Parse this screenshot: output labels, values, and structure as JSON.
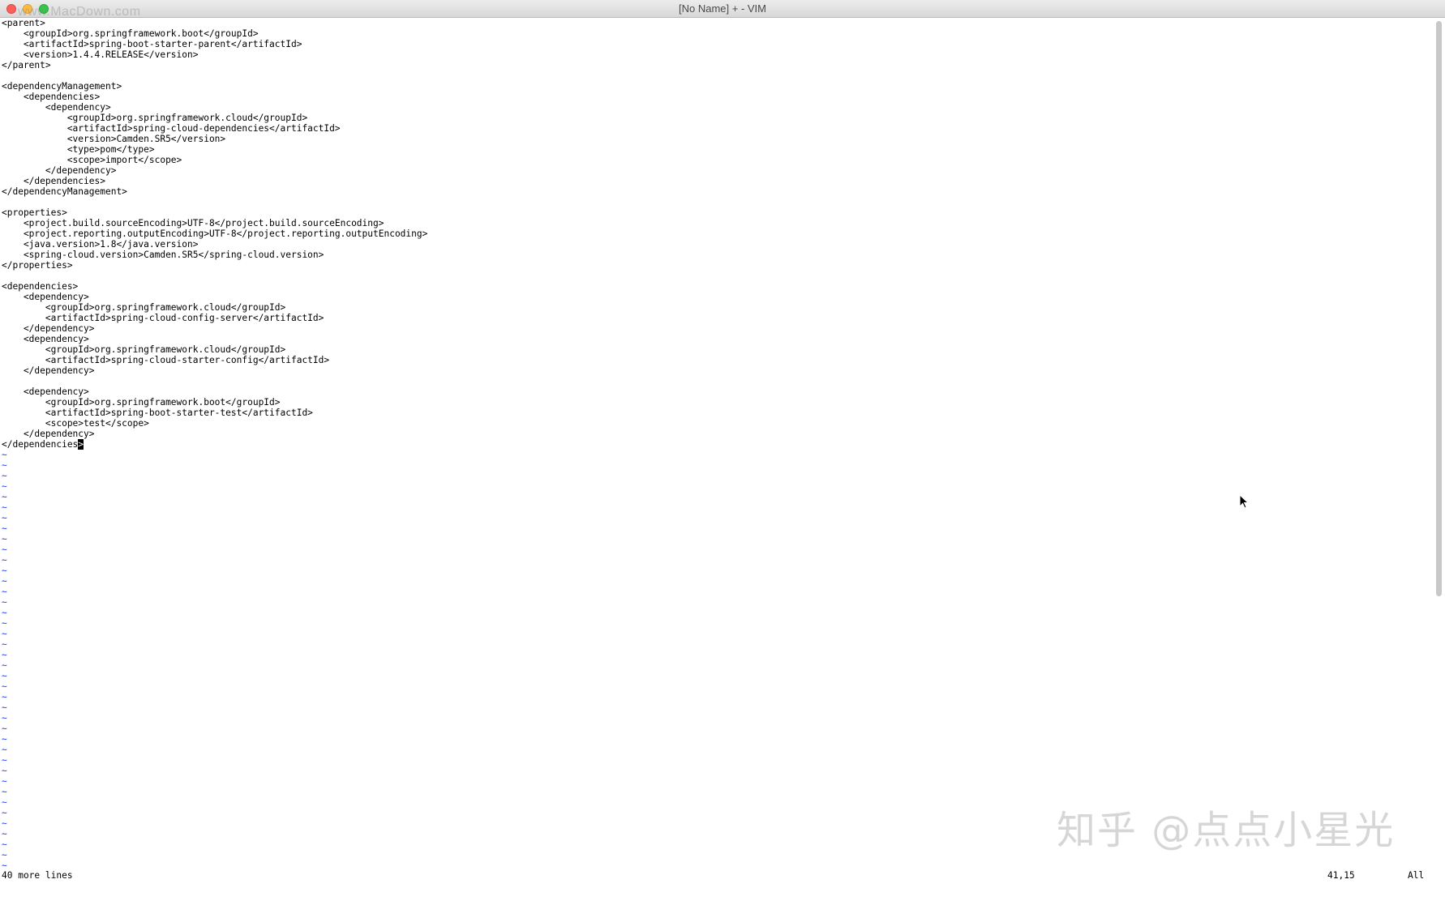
{
  "window": {
    "title": "[No Name] + - VIM",
    "watermark_top": "www.MacDown.com",
    "watermark_bottom": "知乎 @点点小星光"
  },
  "editor": {
    "lines": [
      "<parent>",
      "    <groupId>org.springframework.boot</groupId>",
      "    <artifactId>spring-boot-starter-parent</artifactId>",
      "    <version>1.4.4.RELEASE</version>",
      "</parent>",
      "",
      "<dependencyManagement>",
      "    <dependencies>",
      "        <dependency>",
      "            <groupId>org.springframework.cloud</groupId>",
      "            <artifactId>spring-cloud-dependencies</artifactId>",
      "            <version>Camden.SR5</version>",
      "            <type>pom</type>",
      "            <scope>import</scope>",
      "        </dependency>",
      "    </dependencies>",
      "</dependencyManagement>",
      "",
      "<properties>",
      "    <project.build.sourceEncoding>UTF-8</project.build.sourceEncoding>",
      "    <project.reporting.outputEncoding>UTF-8</project.reporting.outputEncoding>",
      "    <java.version>1.8</java.version>",
      "    <spring-cloud.version>Camden.SR5</spring-cloud.version>",
      "</properties>",
      "",
      "<dependencies>",
      "    <dependency>",
      "        <groupId>org.springframework.cloud</groupId>",
      "        <artifactId>spring-cloud-config-server</artifactId>",
      "    </dependency>",
      "    <dependency>",
      "        <groupId>org.springframework.cloud</groupId>",
      "        <artifactId>spring-cloud-starter-config</artifactId>",
      "    </dependency>",
      "",
      "    <dependency>",
      "        <groupId>org.springframework.boot</groupId>",
      "        <artifactId>spring-boot-starter-test</artifactId>",
      "        <scope>test</scope>",
      "    </dependency>"
    ],
    "cursor_line_before": "</dependencies",
    "cursor_char": ">",
    "tilde_char": "~",
    "tilde_count": 40
  },
  "status": {
    "message": "40 more lines",
    "position": "41,15",
    "percent": "All"
  },
  "colors": {
    "tilde": "#1b3cff",
    "text": "#000000",
    "background": "#ffffff"
  },
  "icons": {
    "mouse_pointer": "arrow-cursor-icon"
  }
}
